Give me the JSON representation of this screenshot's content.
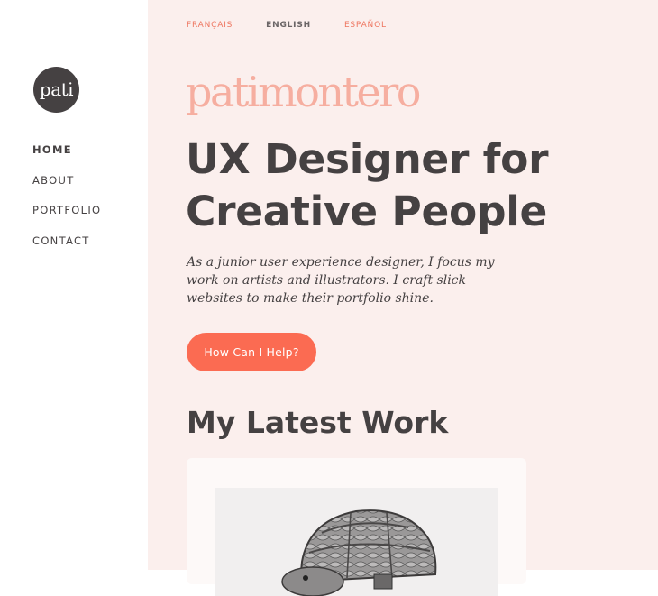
{
  "sidebar": {
    "logo_text": "pati",
    "nav": [
      {
        "label": "HOME",
        "active": true
      },
      {
        "label": "ABOUT",
        "active": false
      },
      {
        "label": "PORTFOLIO",
        "active": false
      },
      {
        "label": "CONTACT",
        "active": false
      }
    ]
  },
  "languages": [
    "FRANÇAIS",
    "ENGLISH",
    "ESPAÑOL"
  ],
  "current_language": "ENGLISH",
  "hero": {
    "wordmark": "patimontero",
    "headline_line1": "UX Designer for",
    "headline_line2": "Creative People",
    "intro": "As a junior user experience designer, I focus my work on artists and illustrators. I craft slick websites to make their portfolio shine.",
    "cta_label": "How Can I Help?"
  },
  "work": {
    "heading": "My Latest Work",
    "first_item_image": "tortoise-illustration"
  },
  "colors": {
    "accent": "#fb6b52",
    "wordmark": "#f6aea0",
    "main_background": "#fbefed",
    "text": "#454142"
  }
}
